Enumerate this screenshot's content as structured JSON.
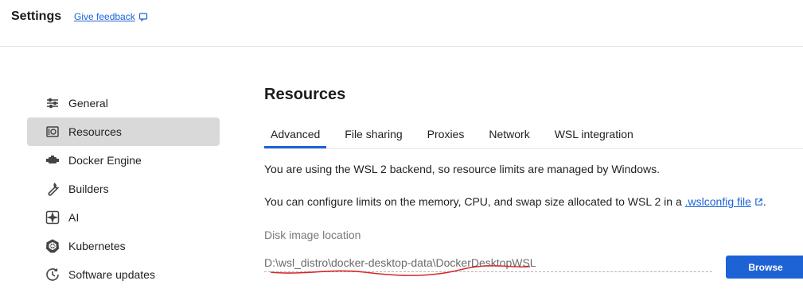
{
  "app": {
    "title": "Settings",
    "feedback_label": "Give feedback"
  },
  "sidebar": {
    "items": [
      {
        "label": "General",
        "icon": "sliders-icon",
        "active": false
      },
      {
        "label": "Resources",
        "icon": "resources-icon",
        "active": true
      },
      {
        "label": "Docker Engine",
        "icon": "engine-icon",
        "active": false
      },
      {
        "label": "Builders",
        "icon": "wrench-icon",
        "active": false
      },
      {
        "label": "AI",
        "icon": "ai-icon",
        "active": false
      },
      {
        "label": "Kubernetes",
        "icon": "kubernetes-icon",
        "active": false
      },
      {
        "label": "Software updates",
        "icon": "clock-update-icon",
        "active": false
      }
    ]
  },
  "main": {
    "title": "Resources",
    "tabs": [
      {
        "label": "Advanced",
        "active": true
      },
      {
        "label": "File sharing",
        "active": false
      },
      {
        "label": "Proxies",
        "active": false
      },
      {
        "label": "Network",
        "active": false
      },
      {
        "label": "WSL integration",
        "active": false
      }
    ],
    "info_text": "You are using the WSL 2 backend, so resource limits are managed by Windows.",
    "config_text_prefix": "You can configure limits on the memory, CPU, and swap size allocated to WSL 2 in a",
    "config_link": ".wslconfig file",
    "config_text_suffix": ".",
    "disk_label": "Disk image location",
    "disk_path": "D:\\wsl_distro\\docker-desktop-data\\DockerDesktopWSL",
    "browse_label": "Browse"
  },
  "colors": {
    "accent": "#1d63d6",
    "active_bg": "#d9d9d9",
    "annotation": "#d62828"
  }
}
